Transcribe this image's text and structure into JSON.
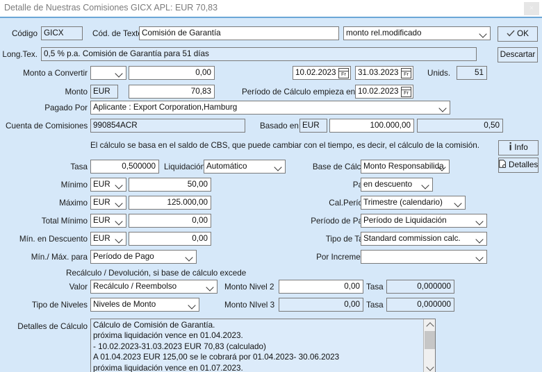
{
  "window": {
    "title": "Detalle de Nuestras Comisiones GICX APL: EUR 70,83",
    "close_label": "×"
  },
  "buttons": {
    "ok": "OK",
    "discard": "Descartar",
    "info": "Info",
    "details": "Detalles"
  },
  "row_code": {
    "code_label": "Código",
    "code_value": "GICX",
    "text_code_label": "Cód. de Texto",
    "text_code_value": "Comisión de Garantía",
    "type_value": "monto rel.modificado"
  },
  "row_longtext": {
    "label": "Long.Tex.",
    "value": "0,5 % p.a. Comisión de Garantía para 51 días"
  },
  "row_convert": {
    "label": "Monto a Convertir",
    "currency": "",
    "amount": "0,00",
    "date_from": "10.02.2023",
    "date_to": "31.03.2023",
    "units_label": "Unids.",
    "units_value": "51",
    "cal_glyph": "Fr"
  },
  "row_amount": {
    "label": "Monto",
    "currency": "EUR",
    "amount": "70,83",
    "period_label": "Período de Cálculo empieza en",
    "period_date": "10.02.2023"
  },
  "row_paidby": {
    "label": "Pagado Por",
    "value": "Aplicante : Export Corporation,Hamburg"
  },
  "row_account": {
    "label": "Cuenta de Comisiones",
    "value": "990854ACR",
    "based_label": "Basado en",
    "based_currency": "EUR",
    "based_amount": "100.000,00",
    "based_rate": "0,50"
  },
  "note": "El cálculo se basa en el saldo de CBS, que puede cambiar con el tiempo, es decir, el cálculo de la comisión.",
  "left_fields": [
    {
      "label": "Tasa",
      "value": "0,500000"
    },
    {
      "label": "Mínimo",
      "currency": "EUR",
      "value": "50,00"
    },
    {
      "label": "Máximo",
      "currency": "EUR",
      "value": "125.000,00"
    },
    {
      "label": "Total Mínimo",
      "currency": "EUR",
      "value": "0,00"
    },
    {
      "label": "Mín. en Descuento",
      "currency": "EUR",
      "value": "0,00"
    },
    {
      "label": "Mín./ Máx. para",
      "value": "Período de Pago"
    }
  ],
  "settlement": {
    "label": "Liquidación",
    "value": "Automático"
  },
  "right_fields": [
    {
      "label": "Base de Cálculo",
      "value": "Monto Responsabilida"
    },
    {
      "label": "Pago",
      "value": "en descuento"
    },
    {
      "label": "Cal.Período",
      "value": "Trimestre (calendario)"
    },
    {
      "label": "Período de Pago",
      "value": "Período de Liquidación"
    },
    {
      "label": "Tipo de Tasa",
      "value": "Standard commission calc."
    },
    {
      "label": "Por Incremento",
      "value": ""
    }
  ],
  "recalc": {
    "heading": "Recálculo / Devolución, si base de cálculo excede",
    "value_label": "Valor",
    "value_value": "Recálculo / Reembolso",
    "levels_label": "Tipo de Niveles",
    "levels_value": "Niveles de Monto",
    "level2_label": "Monto Nivel 2",
    "level2_amount": "0,00",
    "level2_rate_label": "Tasa",
    "level2_rate": "0,000000",
    "level3_label": "Monto NIvel 3",
    "level3_amount": "0,00",
    "level3_rate_label": "Tasa",
    "level3_rate": "0,000000"
  },
  "details": {
    "label": "Detalles de Cálculo",
    "lines": [
      "Cálculo de Comisión de Garantía.",
      "próxima liquidación vence en 01.04.2023.",
      "- 10.02.2023-31.03.2023 EUR 70,83 (calculado)",
      "A 01.04.2023 EUR 125,00 se le cobrará por 01.04.2023- 30.06.2023",
      "próxima liquidación vence en 01.07.2023."
    ]
  },
  "colors": {
    "background": "#d6e8f9",
    "readonly_field": "#dcebfa",
    "border": "#7a7a7a",
    "title_text": "#7b7b7b"
  }
}
